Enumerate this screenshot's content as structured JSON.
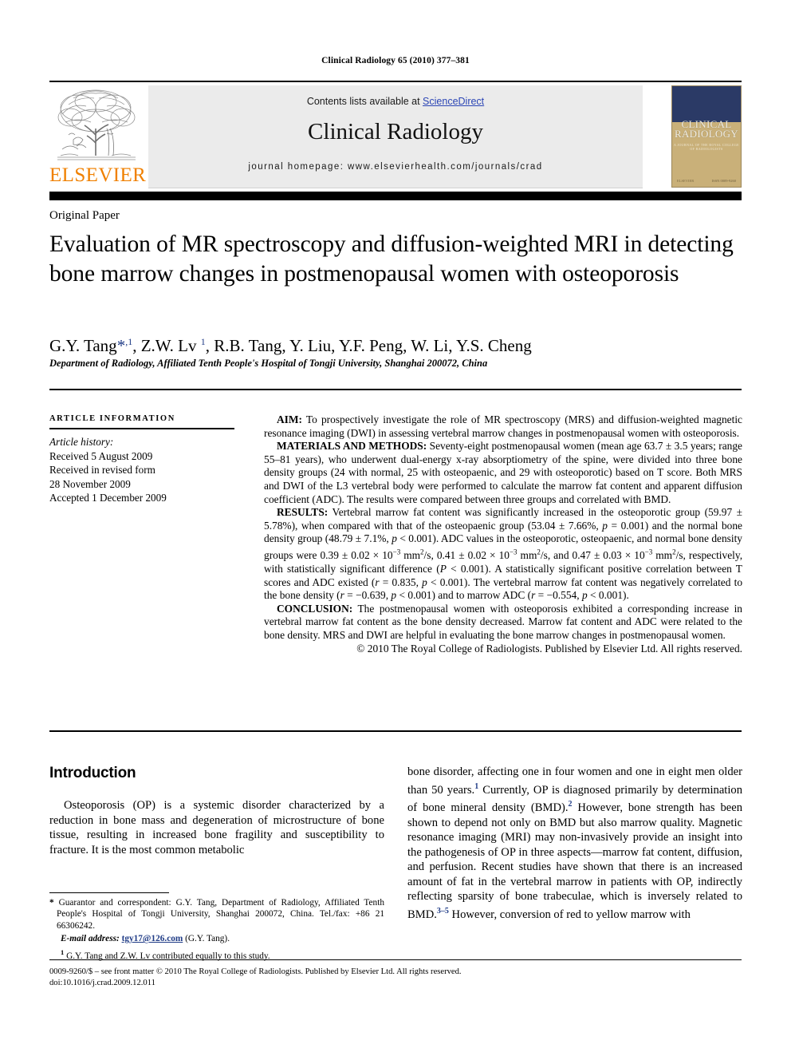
{
  "running_head": "Clinical Radiology 65 (2010) 377–381",
  "masthead": {
    "contents_prefix": "Contents lists available at ",
    "sciencedirect": "ScienceDirect",
    "journal_name": "Clinical Radiology",
    "homepage": "journal homepage: www.elsevierhealth.com/journals/crad",
    "elsevier_wordmark": "ELSEVIER",
    "cover": {
      "title_line1": "CLINICAL",
      "title_line2": "RADIOLOGY",
      "subtitle": "A JOURNAL OF THE ROYAL COLLEGE OF RADIOLOGISTS",
      "foot_left": "ELSEVIER",
      "foot_right": "ISSN 0009-9260"
    },
    "colors": {
      "elsevier_orange": "#F08000",
      "link_blue": "#2b45b5",
      "band_grey": "#ebebeb",
      "cover_navy": "#2b3a66",
      "cover_tan": "#c9b079"
    }
  },
  "article_type": "Original Paper",
  "title": "Evaluation of MR spectroscopy and diffusion-weighted MRI in detecting bone marrow changes in postmenopausal women with osteoporosis",
  "authors_html": "G.Y. Tang<span class=\"star\">*</span><sup>,1</sup>, Z.W. Lv <sup>1</sup>, R.B. Tang, Y. Liu, Y.F. Peng, W. Li, Y.S. Cheng",
  "affiliation": "Department of Radiology, Affiliated Tenth People's Hospital of Tongji University, Shanghai 200072, China",
  "article_info": {
    "heading": "Article information",
    "history_label": "Article history:",
    "lines": [
      "Received 5 August 2009",
      "Received in revised form",
      "28 November 2009",
      "Accepted 1 December 2009"
    ]
  },
  "abstract": {
    "aim_label": "AIM:",
    "aim_text": " To prospectively investigate the role of MR spectroscopy (MRS) and diffusion-weighted magnetic resonance imaging (DWI) in assessing vertebral marrow changes in postmenopausal women with osteoporosis.",
    "methods_label": "MATERIALS AND METHODS:",
    "methods_text": " Seventy-eight postmenopausal women (mean age 63.7 ± 3.5 years; range 55–81 years), who underwent dual-energy x-ray absorptiometry of the spine, were divided into three bone density groups (24 with normal, 25 with osteopaenic, and 29 with osteoporotic) based on T score. Both MRS and DWI of the L3 vertebral body were performed to calculate the marrow fat content and apparent diffusion coefficient (ADC). The results were compared between three groups and correlated with BMD.",
    "results_label": "RESULTS:",
    "results_html": " Vertebral marrow fat content was significantly increased in the osteoporotic group (59.97 ± 5.78%), when compared with that of the osteopaenic group (53.04 ± 7.66%, <i>p</i> = 0.001) and the normal bone density group (48.79 ± 7.1%, <i>p</i> &lt; 0.001). ADC values in the osteoporotic, osteopaenic, and normal bone density groups were 0.39 ± 0.02 × 10<sup class=\"sm\">−3</sup> mm<sup class=\"sm\">2</sup>/s, 0.41 ± 0.02 × 10<sup class=\"sm\">−3</sup> mm<sup class=\"sm\">2</sup>/s, and 0.47 ± 0.03 × 10<sup class=\"sm\">−3</sup> mm<sup class=\"sm\">2</sup>/s, respectively, with statistically significant difference (<i>P</i> &lt; 0.001). A statistically significant positive correlation between T scores and ADC existed (<i>r</i> = 0.835, <i>p</i> &lt; 0.001). The vertebral marrow fat content was negatively correlated to the bone density (<i>r</i> = −0.639, <i>p</i> &lt; 0.001) and to marrow ADC (<i>r</i> = −0.554, <i>p</i> &lt; 0.001).",
    "conclusion_label": "CONCLUSION:",
    "conclusion_text": " The postmenopausal women with osteoporosis exhibited a corresponding increase in vertebral marrow fat content as the bone density decreased. Marrow fat content and ADC were related to the bone density. MRS and DWI are helpful in evaluating the bone marrow changes in postmenopausal women.",
    "copyright": "© 2010 The Royal College of Radiologists. Published by Elsevier Ltd. All rights reserved."
  },
  "introduction": {
    "heading": "Introduction",
    "left_html": "Osteoporosis (OP) is a systemic disorder characterized by a reduction in bone mass and degeneration of microstructure of bone tissue, resulting in increased bone fragility and susceptibility to fracture. It is the most common metabolic",
    "right_html": "bone disorder, affecting one in four women and one in eight men older than 50 years.<span class=\"ref\">1</span> Currently, OP is diagnosed primarily by determination of bone mineral density (BMD).<span class=\"ref\">2</span> However, bone strength has been shown to depend not only on BMD but also marrow quality. Magnetic resonance imaging (MRI) may non-invasively provide an insight into the pathogenesis of OP in three aspects—marrow fat content, diffusion, and perfusion. Recent studies have shown that there is an increased amount of fat in the vertebral marrow in patients with OP, indirectly reflecting sparsity of bone trabeculae, which is inversely related to BMD.<span class=\"ref\">3–5</span> However, conversion of red to yellow marrow with"
  },
  "footnotes": {
    "corresponding_html": "<b>*</b> Guarantor and correspondent: G.Y. Tang, Department of Radiology, Affiliated Tenth People's Hospital of Tongji University, Shanghai 200072, China. Tel./fax: +86 21 66306242.",
    "email_label": "E-mail address:",
    "email": "tgy17@126.com",
    "email_suffix": " (G.Y. Tang).",
    "equal_contribution_html": "<sup>1</sup> G.Y. Tang and Z.W. Lv contributed equally to this study."
  },
  "bottom": {
    "issn_line": "0009-9260/$ – see front matter © 2010 The Royal College of Radiologists. Published by Elsevier Ltd. All rights reserved.",
    "doi": "doi:10.1016/j.crad.2009.12.011"
  }
}
